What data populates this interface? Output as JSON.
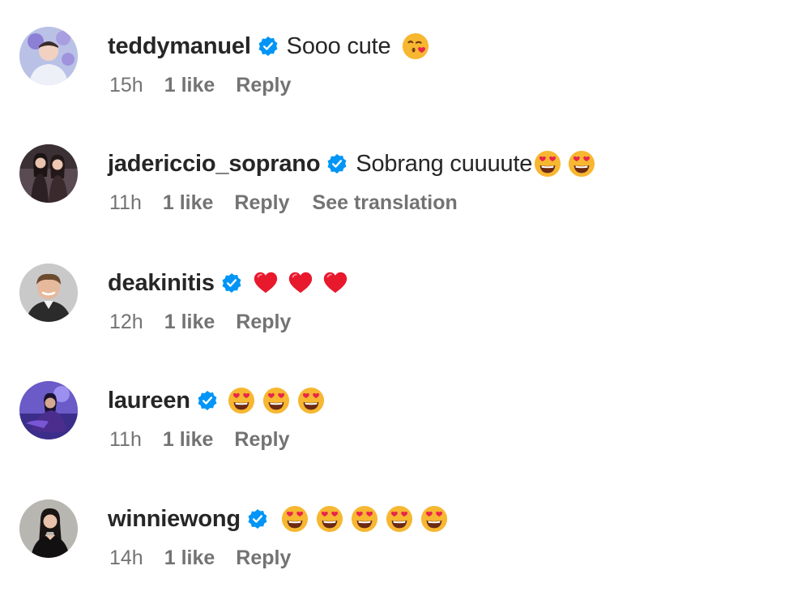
{
  "comments": [
    {
      "username": "teddymanuel",
      "text": "Sooo cute",
      "emojis": [
        "kissing-heart-emoji"
      ],
      "time": "15h",
      "likes": "1 like",
      "reply": "Reply",
      "translation": ""
    },
    {
      "username": "jadericcio_soprano",
      "text": "Sobrang cuuuute",
      "emojis": [
        "heart-eyes-emoji",
        "heart-eyes-emoji"
      ],
      "time": "11h",
      "likes": "1 like",
      "reply": "Reply",
      "translation": "See translation"
    },
    {
      "username": "deakinitis",
      "text": "",
      "emojis": [
        "red-heart-emoji",
        "red-heart-emoji",
        "red-heart-emoji"
      ],
      "time": "12h",
      "likes": "1 like",
      "reply": "Reply",
      "translation": ""
    },
    {
      "username": "laureen",
      "text": "",
      "emojis": [
        "heart-eyes-emoji",
        "heart-eyes-emoji",
        "heart-eyes-emoji"
      ],
      "time": "11h",
      "likes": "1 like",
      "reply": "Reply",
      "translation": ""
    },
    {
      "username": "winniewong",
      "text": "",
      "emojis": [
        "heart-eyes-emoji",
        "heart-eyes-emoji",
        "heart-eyes-emoji",
        "heart-eyes-emoji",
        "heart-eyes-emoji"
      ],
      "time": "14h",
      "likes": "1 like",
      "reply": "Reply",
      "translation": ""
    }
  ],
  "colors": {
    "verified_badge": "#0095f6",
    "meta_text": "#737373",
    "primary_text": "#262626"
  }
}
